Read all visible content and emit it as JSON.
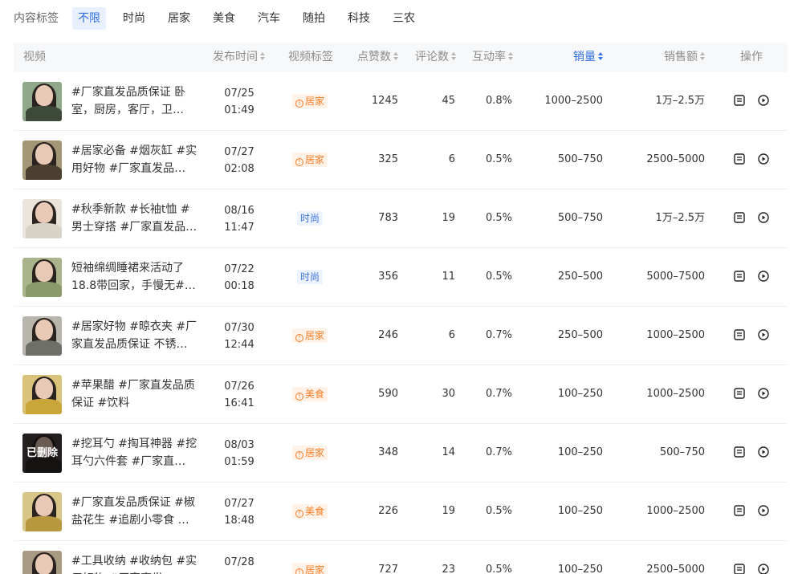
{
  "filter": {
    "label": "内容标签",
    "tags": [
      "不限",
      "时尚",
      "居家",
      "美食",
      "汽车",
      "随拍",
      "科技",
      "三农"
    ],
    "active_index": 0
  },
  "table": {
    "columns": [
      "视频",
      "发布时间",
      "视频标签",
      "点赞数",
      "评论数",
      "互动率",
      "销量",
      "销售额",
      "操作"
    ],
    "sorted_column": "销量",
    "rows": [
      {
        "title": "#厂家直发品质保证 卧室，厨房，客厅，卫…",
        "date": "07/25",
        "time": "01:49",
        "tag": "居家",
        "likes": "1245",
        "comments": "45",
        "rate": "0.8%",
        "sales": "1000–2500",
        "revenue": "1万–2.5万",
        "deleted": false
      },
      {
        "title": "#居家必备 #烟灰缸 #实用好物 #厂家直发品…",
        "date": "07/27",
        "time": "02:08",
        "tag": "居家",
        "likes": "325",
        "comments": "6",
        "rate": "0.5%",
        "sales": "500–750",
        "revenue": "2500–5000",
        "deleted": false
      },
      {
        "title": "#秋季新款 #长袖t恤 #男士穿搭 #厂家直发品…",
        "date": "08/16",
        "time": "11:47",
        "tag": "时尚",
        "likes": "783",
        "comments": "19",
        "rate": "0.5%",
        "sales": "500–750",
        "revenue": "1万–2.5万",
        "deleted": false
      },
      {
        "title": "短袖绵绸睡裙来活动了18.8带回家，手慢无#…",
        "date": "07/22",
        "time": "00:18",
        "tag": "时尚",
        "likes": "356",
        "comments": "11",
        "rate": "0.5%",
        "sales": "250–500",
        "revenue": "5000–7500",
        "deleted": false
      },
      {
        "title": "#居家好物 #晾衣夹 #厂家直发品质保证 不锈…",
        "date": "07/30",
        "time": "12:44",
        "tag": "居家",
        "likes": "246",
        "comments": "6",
        "rate": "0.7%",
        "sales": "250–500",
        "revenue": "1000–2500",
        "deleted": false
      },
      {
        "title": "#苹果醋 #厂家直发品质保证 #饮料",
        "date": "07/26",
        "time": "16:41",
        "tag": "美食",
        "likes": "590",
        "comments": "30",
        "rate": "0.7%",
        "sales": "100–250",
        "revenue": "1000–2500",
        "deleted": false
      },
      {
        "title": "#挖耳勺 #掏耳神器 #挖耳勺六件套 #厂家直…",
        "date": "08/03",
        "time": "01:59",
        "tag": "居家",
        "likes": "348",
        "comments": "14",
        "rate": "0.7%",
        "sales": "100–250",
        "revenue": "500–750",
        "deleted": true,
        "deleted_label": "已删除"
      },
      {
        "title": "#厂家直发品质保证 #椒盐花生 #追剧小零食 …",
        "date": "07/27",
        "time": "18:48",
        "tag": "美食",
        "likes": "226",
        "comments": "19",
        "rate": "0.5%",
        "sales": "100–250",
        "revenue": "1000–2500",
        "deleted": false
      },
      {
        "title": "#工具收纳 #收纳包 #实用好物 #厂家直发…",
        "date": "07/28",
        "time": "",
        "tag": "居家",
        "likes": "727",
        "comments": "23",
        "rate": "0.5%",
        "sales": "100–250",
        "revenue": "2500–5000",
        "deleted": false
      }
    ]
  },
  "colors": {
    "accent": "#2f6fe4",
    "orange_tag": "#fa7d25",
    "blue_tag": "#3d74e0"
  },
  "icons": {
    "detail": "document-icon",
    "play": "play-circle-icon",
    "tag_warn": "info-circle-icon"
  }
}
